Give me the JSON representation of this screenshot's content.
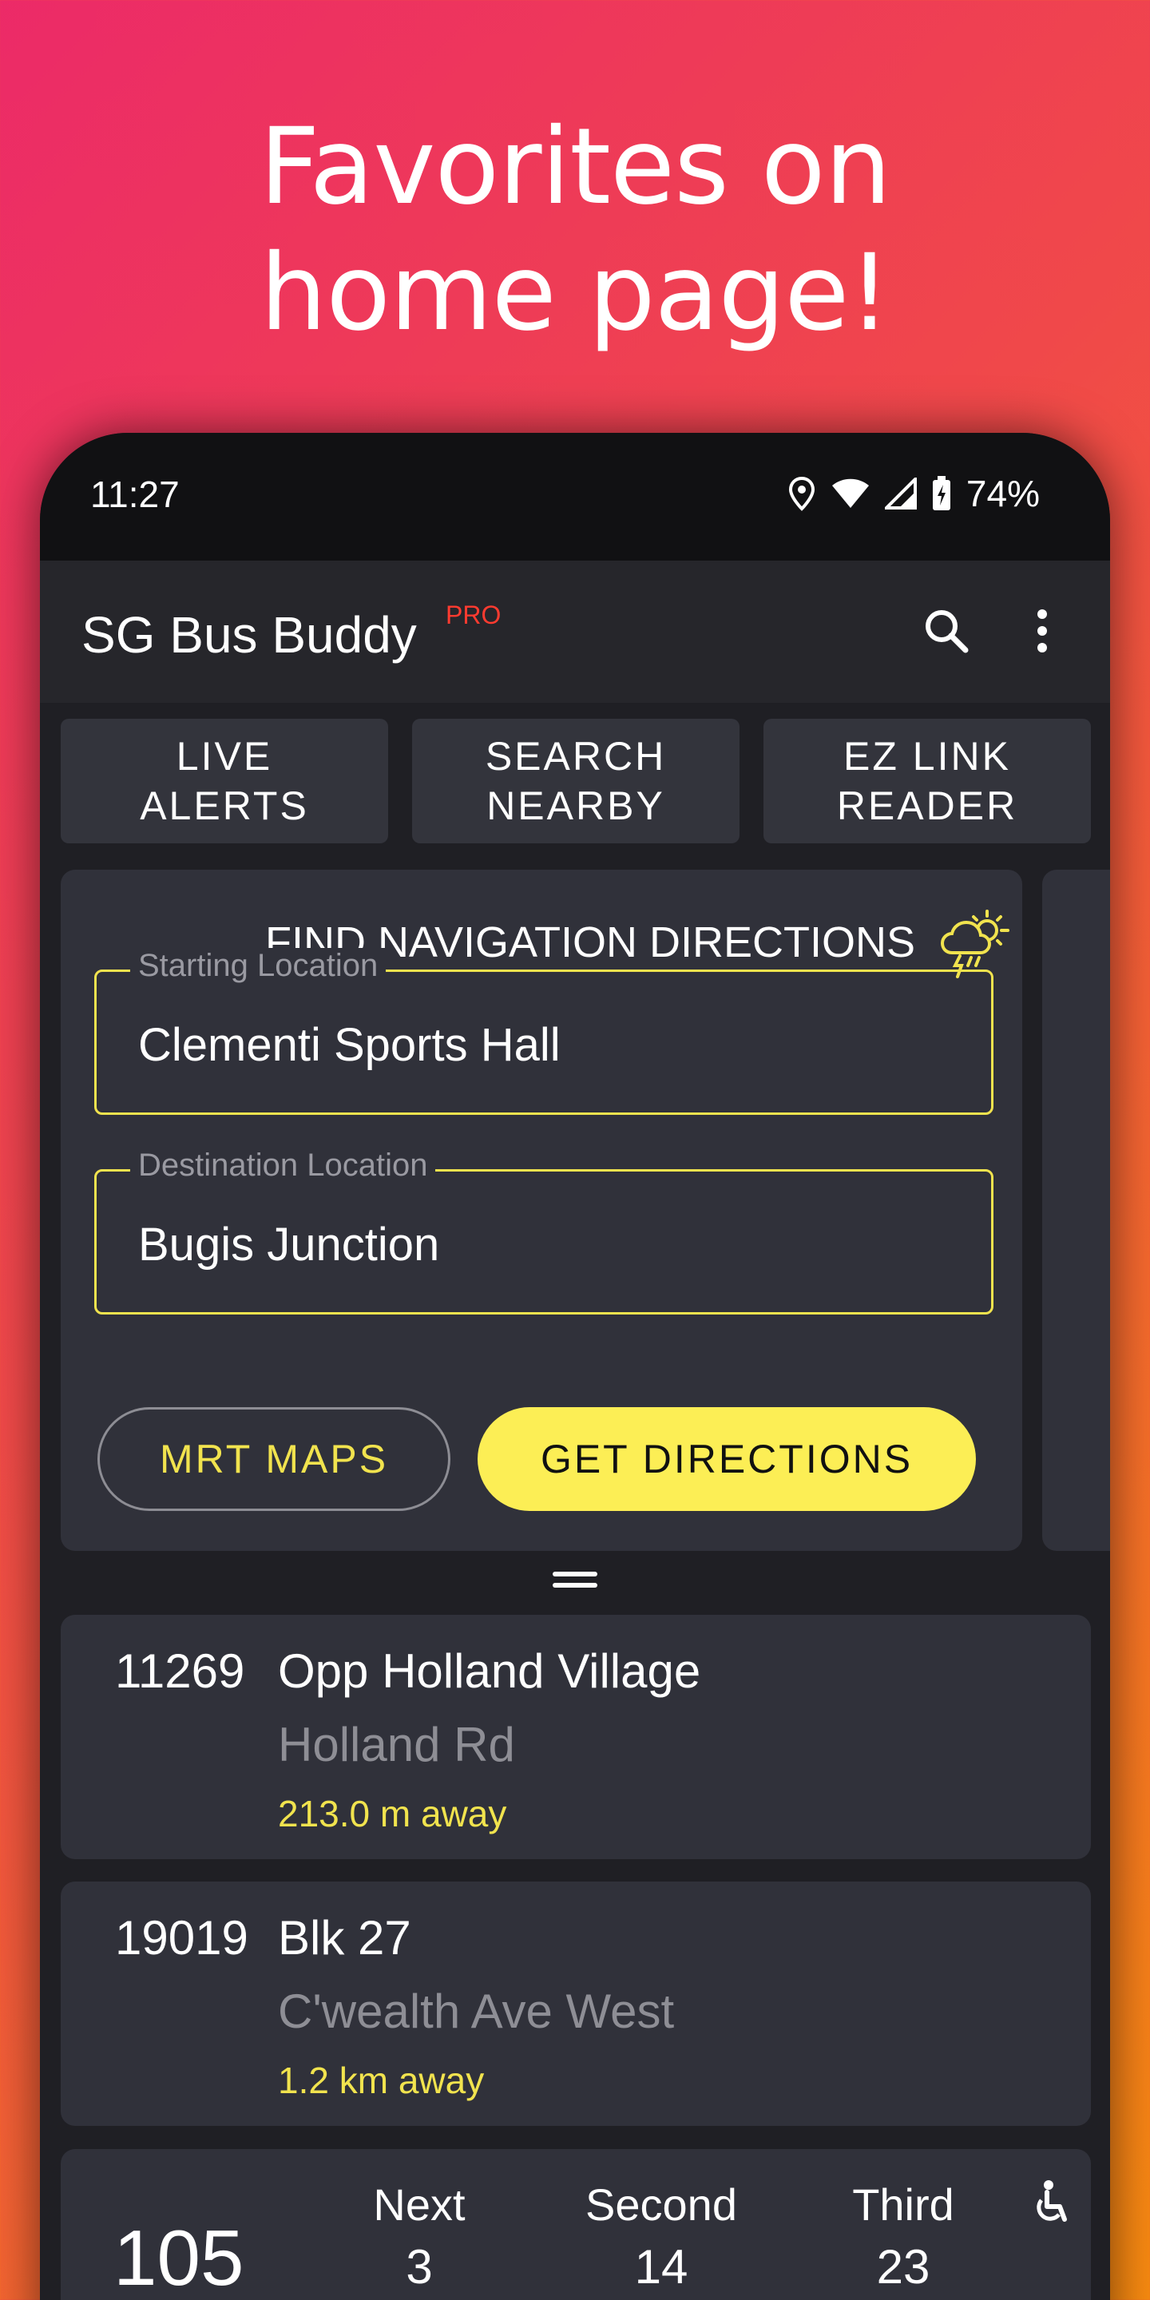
{
  "promo": {
    "headline_line1": "Favorites on",
    "headline_line2": "home page!"
  },
  "status_bar": {
    "time": "11:27",
    "battery": "74%",
    "icons": [
      "location-icon",
      "wifi-icon",
      "signal-icon",
      "battery-charging-icon"
    ]
  },
  "app_bar": {
    "title": "SG Bus Buddy",
    "badge": "PRO",
    "actions": [
      "search-icon",
      "more-vert-icon"
    ]
  },
  "quick_actions": [
    {
      "label": "LIVE\nALERTS"
    },
    {
      "label": "SEARCH\nNEARBY"
    },
    {
      "label": "EZ LINK\nREADER"
    }
  ],
  "navigation": {
    "title": "FIND NAVIGATION DIRECTIONS",
    "weather_icon": "thunderstorm-sun-icon",
    "start_label": "Starting Location",
    "start_value": "Clementi Sports Hall",
    "dest_label": "Destination Location",
    "dest_value": "Bugis Junction",
    "mrt_button": "MRT MAPS",
    "directions_button": "GET DIRECTIONS"
  },
  "favorite_stops": [
    {
      "code": "11269",
      "name": "Opp Holland Village",
      "road": "Holland Rd",
      "distance": "213.0 m away"
    },
    {
      "code": "19019",
      "name": "Blk 27",
      "road": "C'wealth Ave West",
      "distance": "1.2 km away"
    }
  ],
  "bus_service": {
    "number": "105",
    "arrivals": [
      {
        "label": "Next",
        "minutes": "3"
      },
      {
        "label": "Second",
        "minutes": "14"
      },
      {
        "label": "Third",
        "minutes": "23"
      }
    ],
    "accessibility_icon": "wheelchair-icon"
  },
  "colors": {
    "accent_yellow": "#fcee55",
    "pro_red": "#ff3b30",
    "card_bg": "#30313a",
    "screen_bg": "#1f1f24"
  }
}
